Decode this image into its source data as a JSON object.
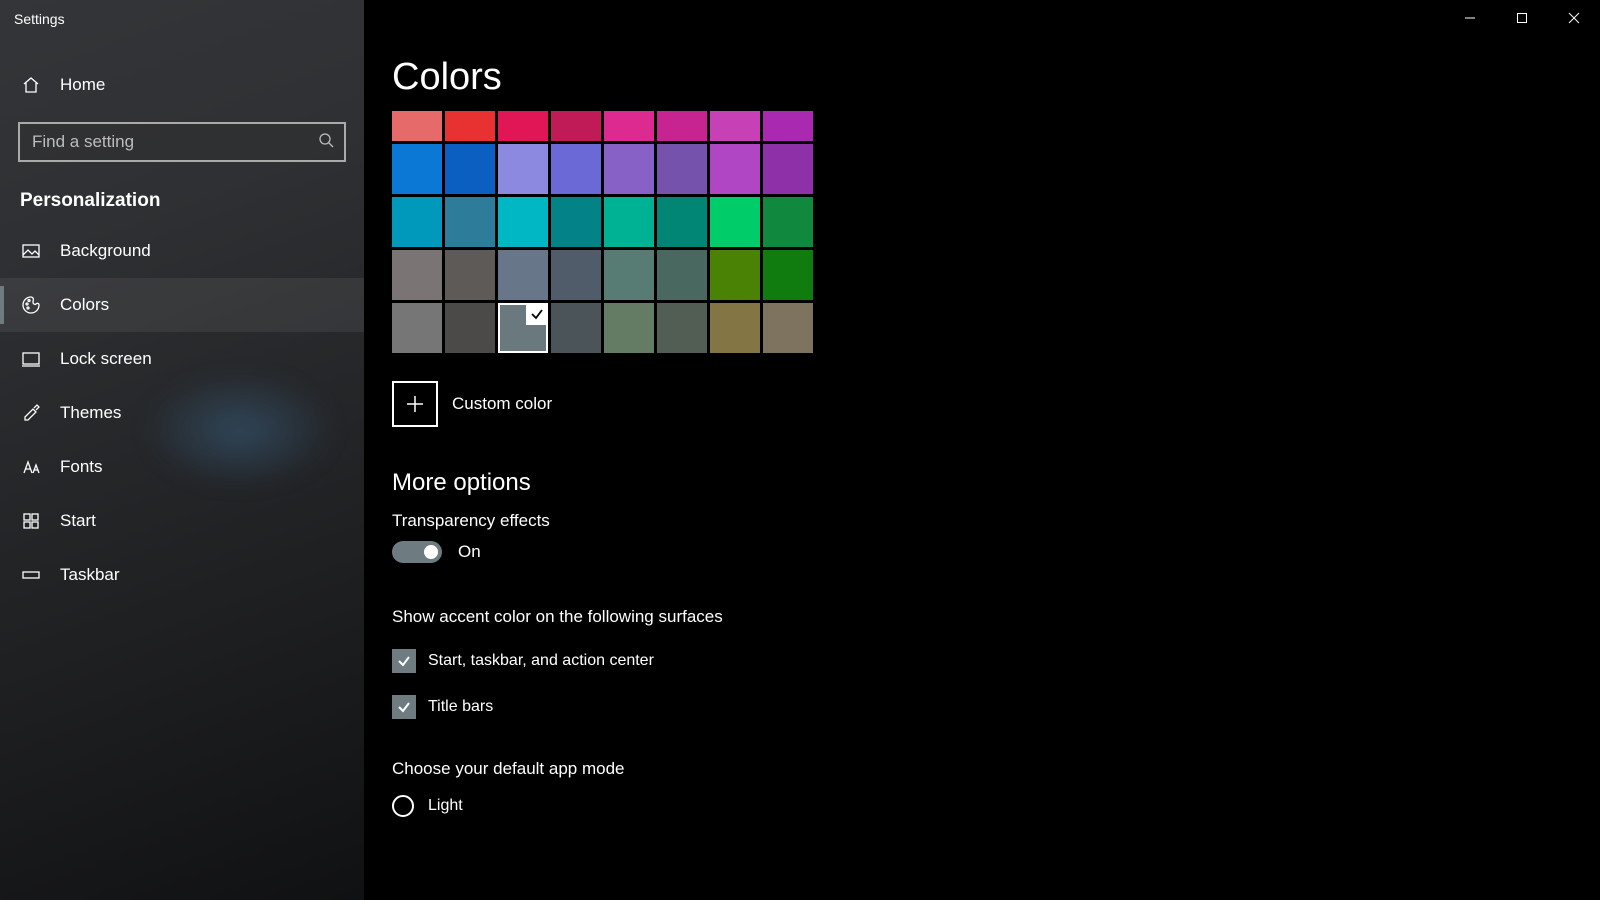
{
  "window": {
    "title": "Settings"
  },
  "sidebar": {
    "home_label": "Home",
    "search_placeholder": "Find a setting",
    "section_title": "Personalization",
    "items": [
      {
        "id": "background",
        "label": "Background"
      },
      {
        "id": "colors",
        "label": "Colors"
      },
      {
        "id": "lock-screen",
        "label": "Lock screen"
      },
      {
        "id": "themes",
        "label": "Themes"
      },
      {
        "id": "fonts",
        "label": "Fonts"
      },
      {
        "id": "start",
        "label": "Start"
      },
      {
        "id": "taskbar",
        "label": "Taskbar"
      }
    ],
    "selected_item": "colors"
  },
  "page": {
    "title": "Colors",
    "swatches": [
      [
        "#e76a6a",
        "#e83131",
        "#e01657",
        "#c01a57",
        "#dd2a91",
        "#c72491",
        "#c840b6",
        "#a92ab0"
      ],
      [
        "#0a78d4",
        "#0a5fc0",
        "#8b89e0",
        "#6b69d6",
        "#8861c6",
        "#7553ad",
        "#b046c3",
        "#8e30a7"
      ],
      [
        "#0099bc",
        "#2d7d9a",
        "#00b7c3",
        "#038387",
        "#00b294",
        "#018574",
        "#00cc6a",
        "#10893e"
      ],
      [
        "#7a7574",
        "#5d5a58",
        "#68768a",
        "#515c6b",
        "#567c73",
        "#486860",
        "#498205",
        "#107c10"
      ],
      [
        "#767676",
        "#4c4a48",
        "#69797e",
        "#4a5459",
        "#647c64",
        "#525e54",
        "#847545",
        "#7e735f"
      ]
    ],
    "first_row_partial": true,
    "selected_swatch": {
      "row": 4,
      "col": 2
    },
    "custom_color_label": "Custom color",
    "more_options": {
      "header": "More options",
      "transparency": {
        "label": "Transparency effects",
        "state_label": "On",
        "on": true
      },
      "surfaces_label": "Show accent color on the following surfaces",
      "surfaces": [
        {
          "id": "start-taskbar-action-center",
          "label": "Start, taskbar, and action center",
          "checked": true
        },
        {
          "id": "title-bars",
          "label": "Title bars",
          "checked": true
        }
      ],
      "app_mode": {
        "label": "Choose your default app mode",
        "options": [
          {
            "id": "light",
            "label": "Light",
            "selected": false
          }
        ]
      }
    },
    "accent_color": "#69797e"
  }
}
